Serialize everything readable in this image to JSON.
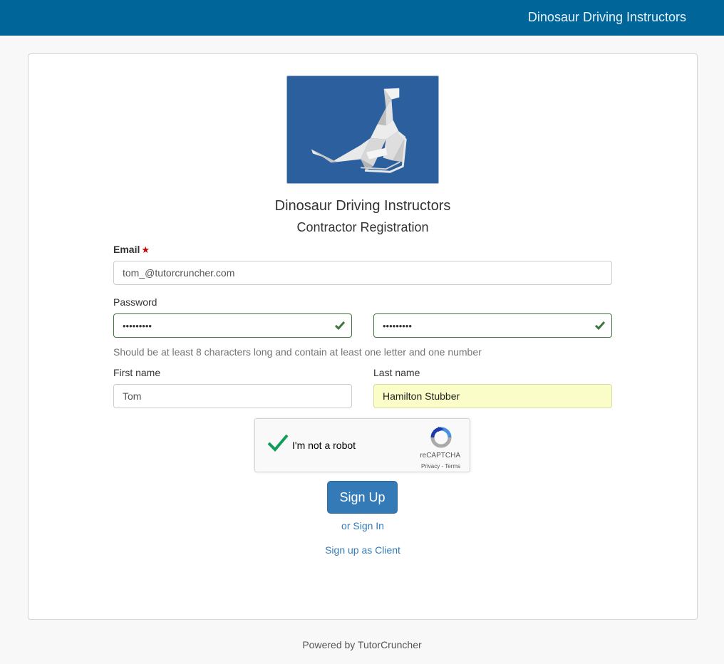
{
  "header": {
    "brand": "Dinosaur Driving Instructors"
  },
  "logo": {
    "icon": "dinosaur-logo-icon",
    "background": "#2b5f9e"
  },
  "form": {
    "org_title": "Dinosaur Driving Instructors",
    "title": "Contractor Registration",
    "email": {
      "label": "Email",
      "required_mark": "★",
      "value": "tom_@tutorcruncher.com"
    },
    "password": {
      "label": "Password",
      "value": "•••••••••",
      "confirm_value": "•••••••••",
      "help": "Should be at least 8 characters long and contain at least one letter and one number"
    },
    "first_name": {
      "label": "First name",
      "value": "Tom"
    },
    "last_name": {
      "label": "Last name",
      "value": "Hamilton Stubber"
    },
    "captcha": {
      "label": "I'm not a robot",
      "brand": "reCAPTCHA",
      "links": "Privacy - Terms",
      "checked": true
    },
    "submit_label": "Sign Up",
    "sign_in_link": "or Sign In",
    "client_link": "Sign up as Client"
  },
  "footer": {
    "text": "Powered by TutorCruncher"
  },
  "colors": {
    "navbar": "#006699",
    "primary": "#337ab7",
    "success": "#3c763d",
    "autofill": "#fafdc8"
  }
}
